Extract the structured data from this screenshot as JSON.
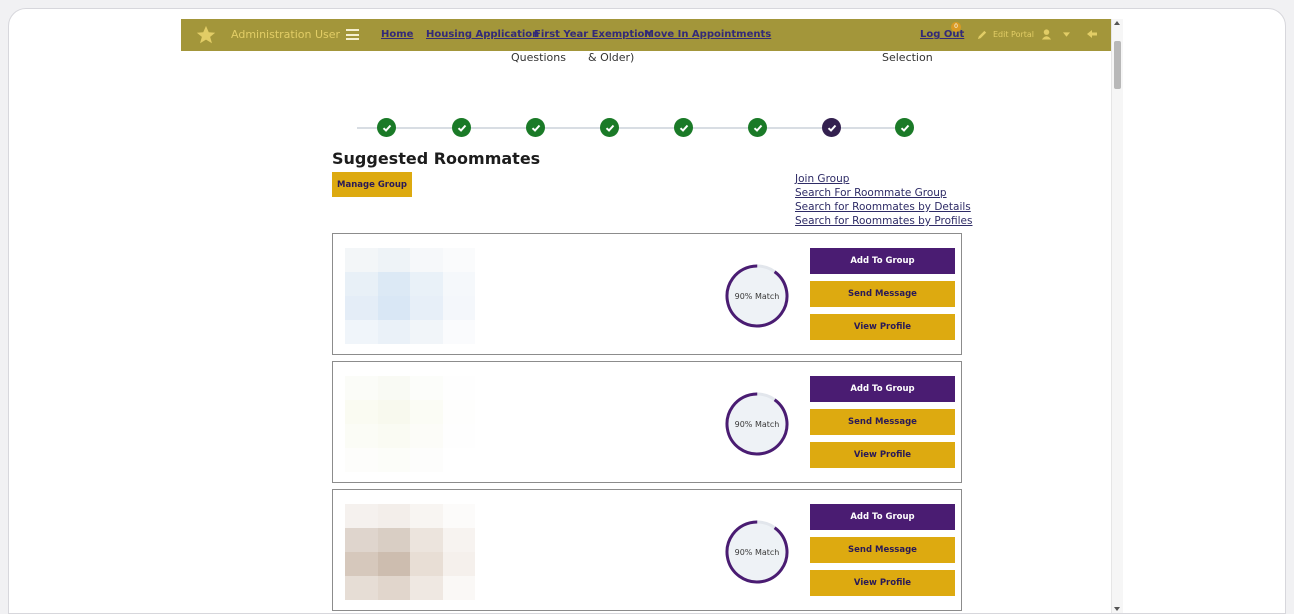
{
  "nav": {
    "user_name": "Administration User",
    "links": [
      "Home",
      "Housing Application",
      "First Year Exemption",
      "Move In Appointments"
    ],
    "logout": "Log Out",
    "badge": "0",
    "edit_portal": "Edit Portal"
  },
  "step_labels": {
    "questions": "Questions",
    "older": "& Older)",
    "selection": "Selection"
  },
  "stepper": {
    "steps": [
      "complete",
      "complete",
      "complete",
      "complete",
      "complete",
      "complete",
      "current",
      "complete"
    ]
  },
  "page": {
    "title": "Suggested Roommates",
    "manage_group": "Manage Group",
    "side_links": [
      "Join Group",
      "Search For Roommate Group",
      "Search for Roommates by Details",
      "Search for Roommates by Profiles"
    ]
  },
  "roommates": [
    {
      "match": "90% Match",
      "match_percent": 90,
      "add": "Add To Group",
      "message": "Send Message",
      "profile": "View Profile"
    },
    {
      "match": "90% Match",
      "match_percent": 90,
      "add": "Add To Group",
      "message": "Send Message",
      "profile": "View Profile"
    },
    {
      "match": "90% Match",
      "match_percent": 90,
      "add": "Add To Group",
      "message": "Send Message",
      "profile": "View Profile"
    }
  ],
  "colors": {
    "nav_bg": "#a3963a",
    "step_done": "#1a7a27",
    "step_current": "#33204f",
    "purple": "#4a1c72",
    "gold": "#ddaa10"
  }
}
